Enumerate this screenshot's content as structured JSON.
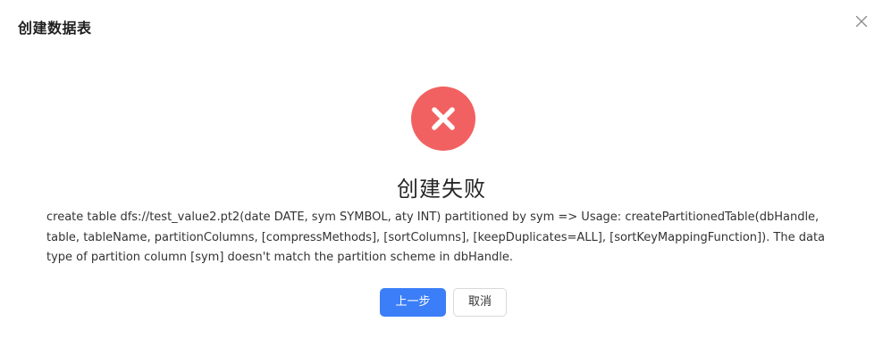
{
  "dialog": {
    "title": "创建数据表",
    "close_icon": "close-icon"
  },
  "result": {
    "status": "error",
    "icon": "error-x-icon",
    "icon_color": "#f26161",
    "title": "创建失败",
    "message": "create table dfs://test_value2.pt2(date DATE, sym SYMBOL, aty INT) partitioned by sym => Usage: createPartitionedTable(dbHandle, table, tableName, partitionColumns, [compressMethods], [sortColumns], [keepDuplicates=ALL], [sortKeyMappingFunction]). The data type of partition column [sym] doesn't match the partition scheme in dbHandle."
  },
  "footer": {
    "prev_label": "上一步",
    "cancel_label": "取消",
    "primary_color": "#3b7ef8"
  }
}
